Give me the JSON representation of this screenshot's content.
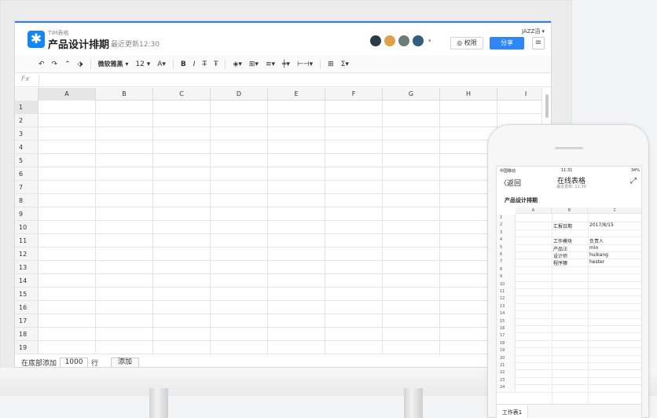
{
  "app": {
    "product_name": "TIM表格",
    "doc_title": "产品设计排期",
    "last_updated": "最近更新12:30",
    "user_name": "JAZZ滔 ▾",
    "permission_label": "◎ 权限",
    "share_label": "分享",
    "menu_icon": "≡"
  },
  "avatars": [
    {
      "name": "avatar-1",
      "color": "#2b3a4a"
    },
    {
      "name": "avatar-2",
      "color": "#e0a04a"
    },
    {
      "name": "avatar-3",
      "color": "#6b7b78"
    },
    {
      "name": "avatar-4",
      "color": "#2f5f7f"
    }
  ],
  "toolbar": {
    "undo": "↶",
    "redo": "↷",
    "clear_format": "⌃",
    "paint": "⬗",
    "font": "微软雅黑 ▾",
    "size": "12 ▾",
    "text_color": "A▾",
    "bold": "B",
    "italic": "I",
    "strike": "T̶",
    "underline": "Ŧ",
    "fill": "◈▾",
    "border": "⊞▾",
    "align": "≡▾",
    "valign": "╪▾",
    "merge": "⊢⊣▾",
    "freeze": "⊞",
    "sum": "Σ▾"
  },
  "formula": {
    "label": "Fx"
  },
  "columns": [
    "A",
    "B",
    "C",
    "D",
    "E",
    "F",
    "G",
    "H",
    "I"
  ],
  "rows": [
    "1",
    "2",
    "3",
    "4",
    "5",
    "6",
    "7",
    "8",
    "9",
    "10",
    "11",
    "12",
    "13",
    "14",
    "15",
    "16",
    "17",
    "18",
    "19"
  ],
  "bottom": {
    "label_before": "在底部添加",
    "count": "1000",
    "label_after": "行",
    "add_button": "添加"
  },
  "phone": {
    "carrier": "中国移动",
    "time": "11:31",
    "battery": "34%",
    "back": "〈返回",
    "title": "在线表格",
    "subtitle": "最近更新: 11:30",
    "share_icon": "⤢",
    "sheet_name": "产品设计排期",
    "columns": [
      "A",
      "B",
      "C"
    ],
    "row_numbers": [
      "1",
      "2",
      "3",
      "4",
      "5",
      "6",
      "7",
      "8",
      "9",
      "10",
      "11",
      "12",
      "13",
      "14",
      "15",
      "16",
      "17",
      "18",
      "19",
      "20",
      "21",
      "22",
      "23",
      "24"
    ],
    "cells": [
      {
        "row": 1,
        "b": "汇报日期",
        "c": "2017/8/15"
      },
      {
        "row": 3,
        "b": "工作模块",
        "c": "负责人"
      },
      {
        "row": 4,
        "b": "产品汪",
        "c": "min"
      },
      {
        "row": 5,
        "b": "设计师",
        "c": "huikang"
      },
      {
        "row": 6,
        "b": "程序猿",
        "c": "hester"
      }
    ],
    "sheet_tab": "工作表1"
  }
}
